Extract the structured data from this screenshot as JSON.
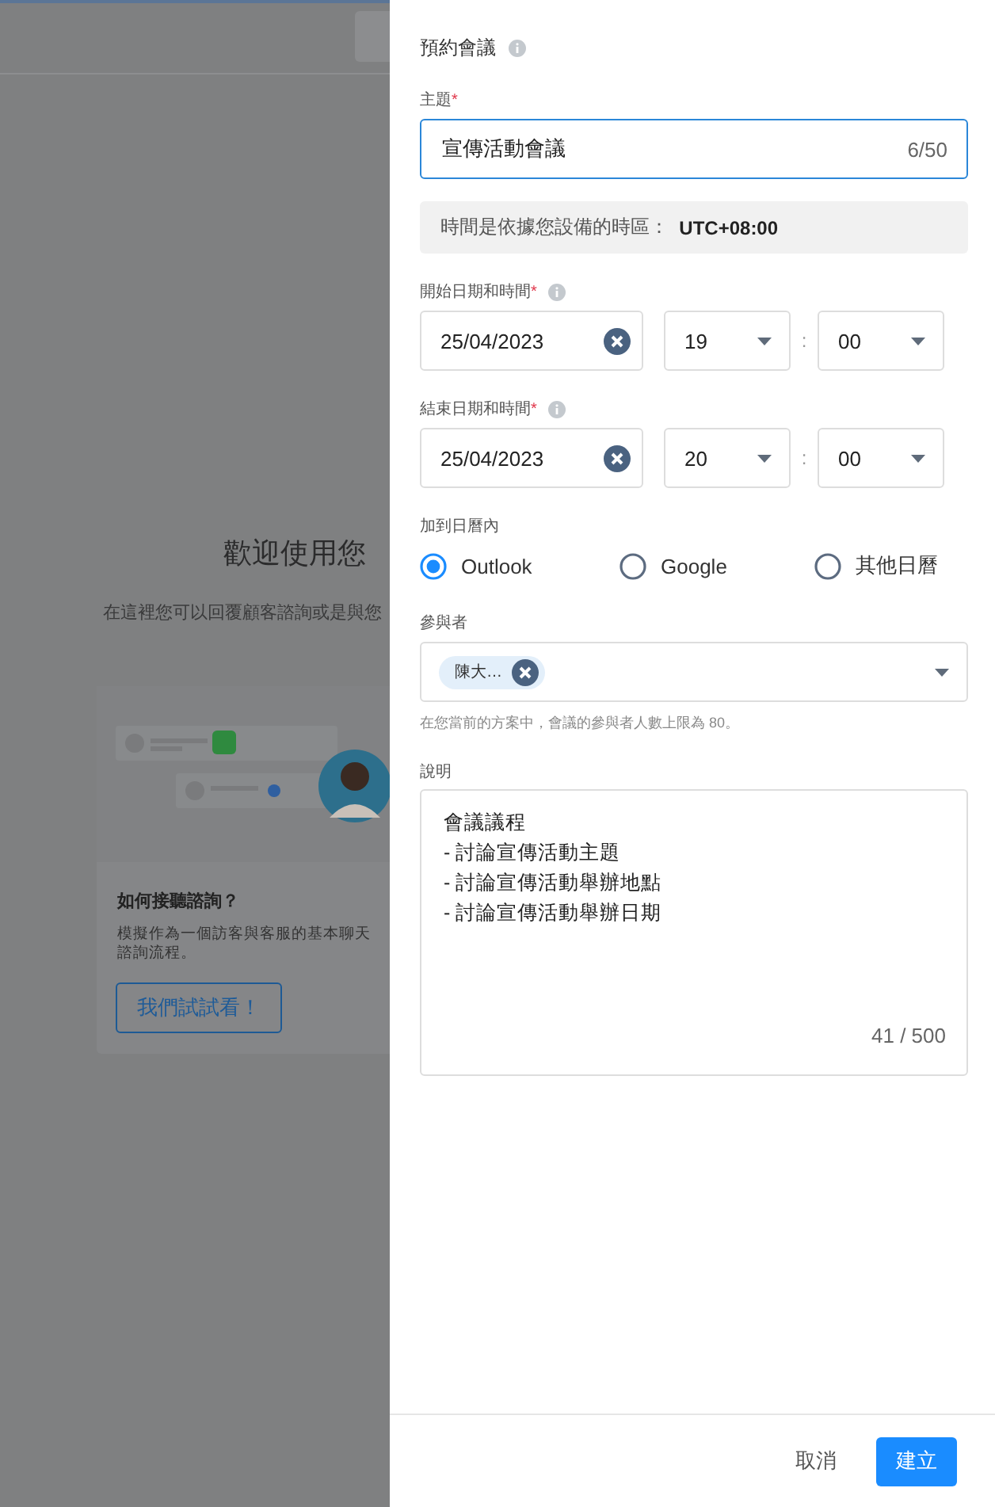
{
  "background": {
    "welcome_title": "歡迎使用您",
    "welcome_subtitle": "在這裡您可以回覆顧客諮詢或是與您",
    "card": {
      "title": "如何接聽諮詢？",
      "description": "模擬作為一個訪客與客服的基本聊天諮詢流程。",
      "button": "我們試試看！"
    }
  },
  "panel": {
    "title": "預約會議",
    "subject": {
      "label": "主題",
      "required_mark": "*",
      "value": "宣傳活動會議",
      "counter": "6/50"
    },
    "timezone_note": "時間是依據您設備的時區：  **UTC+08:00**",
    "start": {
      "label": "開始日期和時間",
      "required_mark": "*",
      "date": "25/04/2023",
      "hour": "19",
      "separator": ":",
      "minute": "00"
    },
    "end": {
      "label": "結束日期和時間",
      "required_mark": "*",
      "date": "25/04/2023",
      "hour": "20",
      "separator": ":",
      "minute": "00"
    },
    "calendar": {
      "label": "加到日曆內",
      "options": [
        {
          "label": "Outlook",
          "selected": true
        },
        {
          "label": "Google",
          "selected": false
        },
        {
          "label": "其他日曆",
          "selected": false
        }
      ]
    },
    "attendees": {
      "label": "參與者",
      "chips": [
        "陳大…"
      ],
      "hint": "在您當前的方案中，會議的參與者人數上限為 80。"
    },
    "description": {
      "label": "說明",
      "lines": [
        "會議議程",
        "- 討論宣傳活動主題",
        "- 討論宣傳活動舉辦地點",
        "- 討論宣傳活動舉辦日期"
      ],
      "counter": "41 / 500"
    },
    "buttons": [
      {
        "label": "取消",
        "kind": "secondary"
      },
      {
        "label": "建立",
        "kind": "primary"
      }
    ]
  }
}
